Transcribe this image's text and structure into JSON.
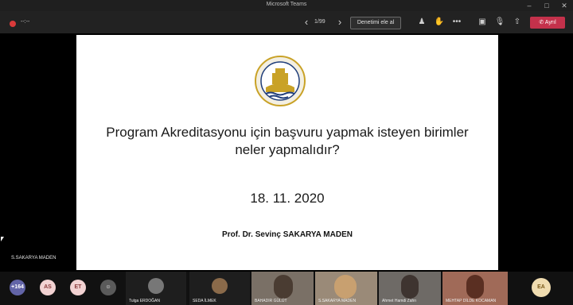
{
  "window": {
    "title": "Microsoft Teams"
  },
  "toolbar": {
    "recording_time": "--:--",
    "page_count": "1/99",
    "take_control_label": "Denetimi ele al",
    "leave_label": "Ayrıl"
  },
  "slide": {
    "title_line1": "Program Akreditasyonu için başvuru yapmak isteyen birimler",
    "title_line2": "neler yapmalıdır?",
    "date": "18. 11. 2020",
    "author": "Prof. Dr. Sevinç SAKARYA MADEN",
    "logo_text": "TRAKYA ÜNİVERSİTESİ"
  },
  "presenter": {
    "name": "S.SAKARYA MADEN"
  },
  "participants": {
    "overflow_count": "+164",
    "avatars": [
      {
        "initials": "AS",
        "color": "#f2d2d2"
      },
      {
        "initials": "ET",
        "color": "#f2d2d2"
      },
      {
        "initials": "EA",
        "color": "#f0dcb0"
      }
    ],
    "tiles": [
      {
        "name": "Tulga ERDOĞAN"
      },
      {
        "name": "SEDA İLMEK"
      },
      {
        "name": "BAHADIR GÜLÜT"
      },
      {
        "name": "S.SAKARYA MADEN"
      },
      {
        "name": "Ahmet Hamdi Zahn"
      },
      {
        "name": "MEHTAP DİLDE KOCAMAN"
      }
    ]
  }
}
